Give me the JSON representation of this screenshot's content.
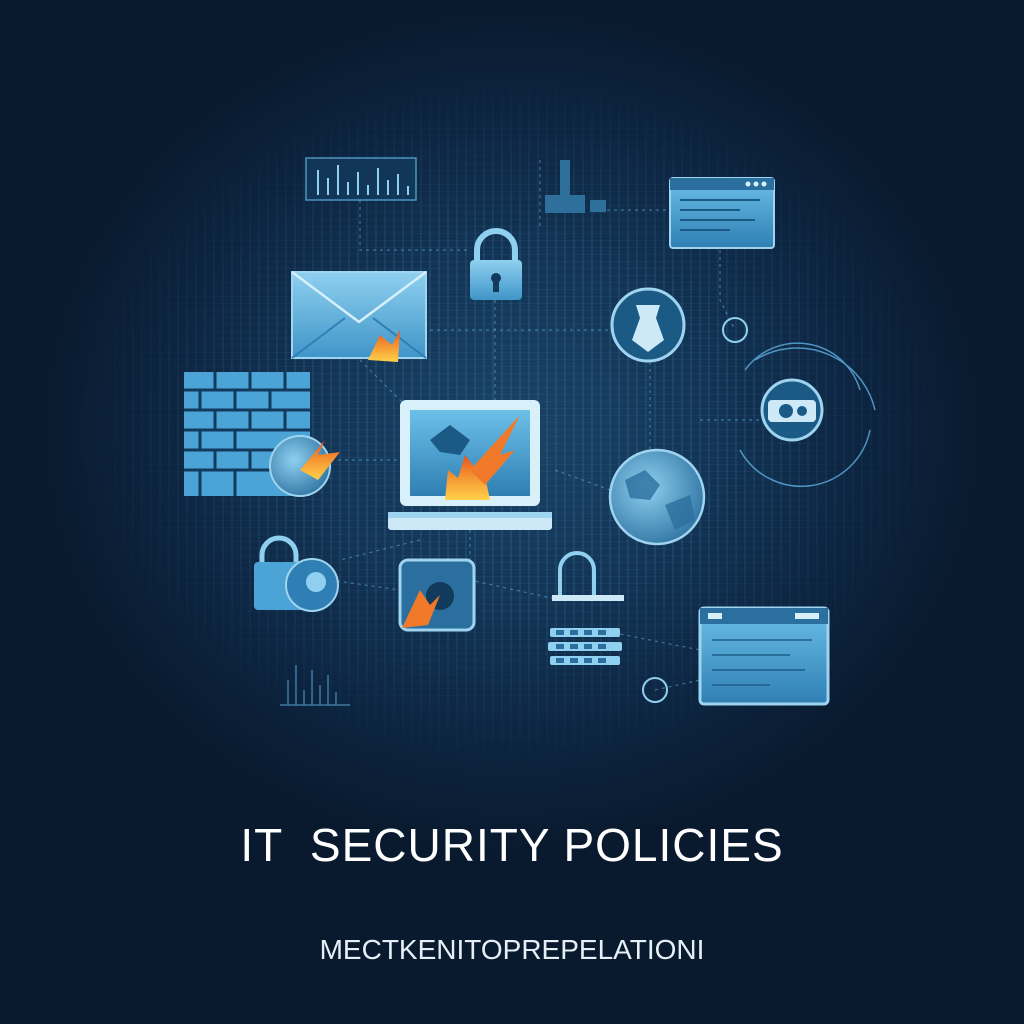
{
  "poster": {
    "title": "IT  SECURITY POLICIES",
    "subtitle": "MECTKENITOPREPELATIONI"
  },
  "icons": [
    "chart-panel-icon",
    "padlock-icon",
    "browser-window-icon",
    "envelope-icon",
    "shield-icon",
    "firewall-icon",
    "laptop-fire-icon",
    "globe-icon",
    "security-camera-icon",
    "padlock-icon",
    "app-icon",
    "server-rack-icon",
    "browser-window-icon"
  ],
  "colors": {
    "background": "#0a1a2e",
    "glow": "#1a4468",
    "icon_fill": "#4ba3d6",
    "icon_light": "#9fd4f0",
    "line": "#5fb0e0",
    "fire": "#f07a2a",
    "text": "#ffffff"
  }
}
